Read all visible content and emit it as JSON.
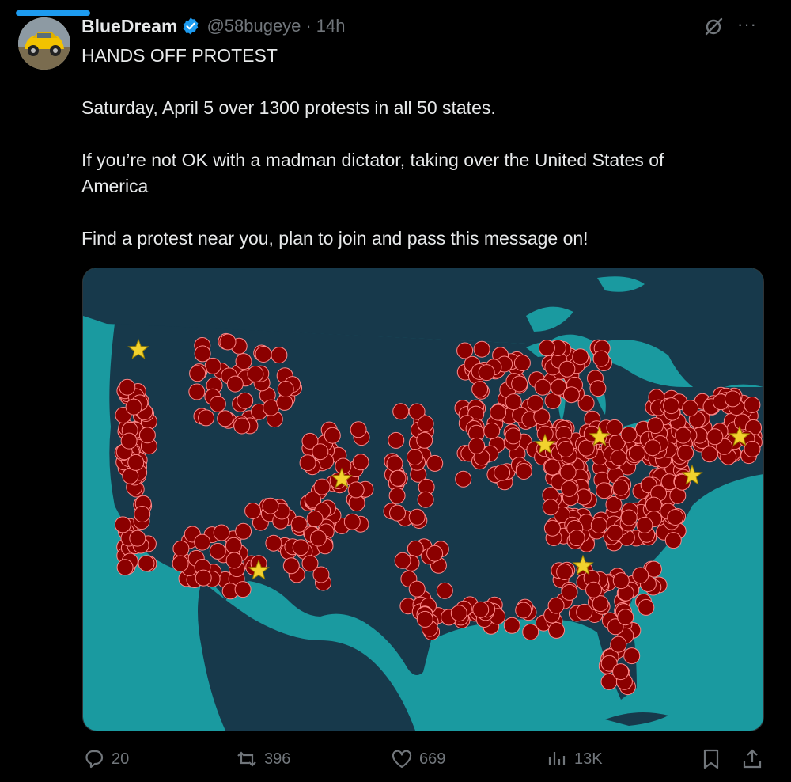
{
  "post": {
    "author_name": "BlueDream",
    "author_handle": "@58bugeye",
    "separator": "·",
    "time": "14h",
    "more": "···",
    "lines": [
      "HANDS OFF PROTEST",
      "Saturday, April 5 over 1300 protests in all 50 states.",
      "If you’re not OK with a madman dictator, taking over the United States of",
      "America",
      "Find a protest near you, plan to join and pass this message on!"
    ]
  },
  "actions": {
    "replies": "20",
    "reposts": "396",
    "likes": "669",
    "views": "13K"
  },
  "icons": {
    "verified": "verified-badge-icon",
    "grok": "grok-icon",
    "reply": "reply-icon",
    "repost": "repost-icon",
    "like": "heart-icon",
    "views": "views-bar-chart-icon",
    "bookmark": "bookmark-icon",
    "share": "share-icon"
  },
  "colors": {
    "accent": "#1d9bf0",
    "text": "#e7e9ea",
    "muted": "#71767b",
    "map_ocean": "#1a9aa0",
    "map_land": "#17394b",
    "marker": "#8b0000",
    "marker_star": "#f2d22e"
  },
  "media": {
    "kind": "map of protest locations across the United States",
    "star_markers": 8
  }
}
